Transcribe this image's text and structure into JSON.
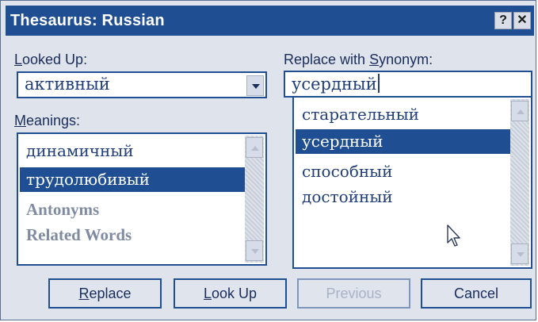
{
  "window": {
    "title": "Thesaurus: Russian",
    "help_label": "?",
    "close_label": "✕"
  },
  "looked_up": {
    "label_u": "L",
    "label_rest": "ooked Up:",
    "value": "активный"
  },
  "meanings": {
    "label_u": "M",
    "label_rest": "eanings:",
    "items": [
      {
        "label": "динамичный",
        "selected": false
      },
      {
        "label": "трудолюбивый",
        "selected": true
      },
      {
        "label": "Antonyms",
        "selected": false
      },
      {
        "label": "Related Words",
        "selected": false
      }
    ]
  },
  "replace_with": {
    "label_pre": "Replace with ",
    "label_u": "S",
    "label_rest": "ynonym:",
    "value": "усердный"
  },
  "synonyms": {
    "items": [
      {
        "label": "старательный",
        "selected": false
      },
      {
        "label": "усердный",
        "selected": true
      },
      {
        "label": "способный",
        "selected": false
      },
      {
        "label": "достойный",
        "selected": false
      }
    ]
  },
  "buttons": {
    "replace_u": "R",
    "replace_rest": "eplace",
    "lookup_u": "L",
    "lookup_rest": "ook Up",
    "previous": "Previous",
    "cancel": "Cancel"
  },
  "colors": {
    "accent": "#1f4f92",
    "panel": "#dee3ec",
    "text": "#1f3e7a",
    "disabled_text": "#aab3c6"
  },
  "icons": {
    "dropdown": "chevron-down-icon",
    "scroll_up": "arrow-up-icon",
    "scroll_down": "arrow-down-icon",
    "cursor": "mouse-pointer-icon"
  }
}
